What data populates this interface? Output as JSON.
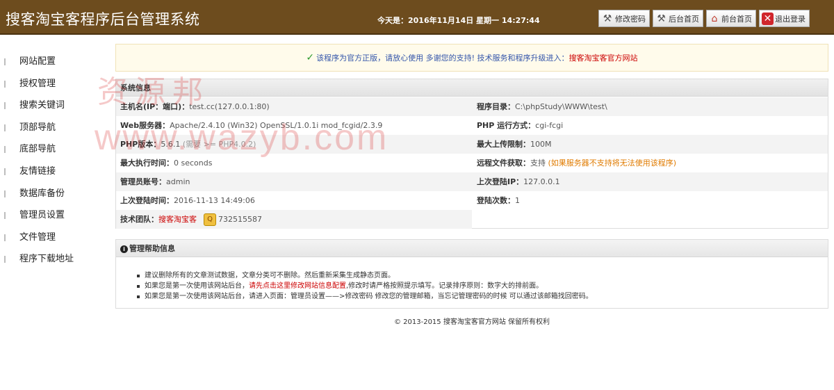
{
  "header": {
    "title": "搜客淘宝客程序后台管理系统",
    "date": "今天是：2016年11月14日 星期一 14:27:44",
    "buttons": [
      {
        "label": "修改密码",
        "icon": "tools-icon"
      },
      {
        "label": "后台首页",
        "icon": "tools-icon"
      },
      {
        "label": "前台首页",
        "icon": "home-icon"
      },
      {
        "label": "退出登录",
        "icon": "close-icon"
      }
    ]
  },
  "sidebar": {
    "items": [
      {
        "label": "网站配置"
      },
      {
        "label": "授权管理"
      },
      {
        "label": "搜索关键词"
      },
      {
        "label": "顶部导航"
      },
      {
        "label": "底部导航"
      },
      {
        "label": "友情链接"
      },
      {
        "label": "数据库备份"
      },
      {
        "label": "管理员设置"
      },
      {
        "label": "文件管理"
      },
      {
        "label": "程序下载地址"
      }
    ]
  },
  "notice": {
    "text": "该程序为官方正版，请放心使用 多谢您的支持! 技术服务和程序升级进入：",
    "link": "搜客淘宝客官方网站"
  },
  "system_info": {
    "title": "系统信息",
    "host_label": "主机名(IP：端口)：",
    "host_value": "test.cc(127.0.0.1:80)",
    "dir_label": "程序目录：",
    "dir_value": "C:\\phpStudy\\WWW\\test\\",
    "web_label": "Web服务器：",
    "web_value": "Apache/2.4.10 (Win32) OpenSSL/1.0.1i mod_fcgid/2.3.9",
    "php_mode_label": "PHP 运行方式：",
    "php_mode_value": "cgi-fcgi",
    "php_ver_label": "PHP版本：",
    "php_ver_value": "5.6.1",
    "php_ver_req": "(需要 >= PHP4.0.2)",
    "upload_label": "最大上传限制：",
    "upload_value": "100M",
    "exec_label": "最大执行时间：",
    "exec_value": "0 seconds",
    "remote_label": "远程文件获取：",
    "remote_value": "支持",
    "remote_note": "(如果服务器不支持将无法使用该程序)",
    "admin_label": "管理员账号：",
    "admin_value": "admin",
    "last_ip_label": "上次登陆IP：",
    "last_ip_value": "127.0.0.1",
    "last_time_label": "上次登陆时间：",
    "last_time_value": "2016-11-13 14:49:06",
    "login_count_label": "登陆次数：",
    "login_count_value": "1",
    "team_label": "技术团队：",
    "team_value": "搜客淘宝客",
    "qq_value": "732515587"
  },
  "help": {
    "title": "管理帮助信息",
    "item1": "建议删除所有的文章测试数据，文章分类可不删除。然后重新采集生成静态页面。",
    "item2_pre": "如果您是第一次使用该网站后台，",
    "item2_link": "请先点击这里修改网站信息配置",
    "item2_post": ",修改时请严格按照提示填写。记录排序原则：数字大的排前面。",
    "item3": "如果您是第一次使用该网站后台，请进入页面：管理员设置——>修改密码 修改您的管理邮箱，当忘记管理密码的时候 可以通过该邮箱找回密码。"
  },
  "footer": {
    "text": "© 2013-2015 搜客淘宝客官方网站 保留所有权利"
  },
  "watermark": {
    "line1": "资源邦",
    "line2": "www.wazyb.com"
  },
  "colors": {
    "header_bg": "#6d4c1e",
    "link_red": "#cc0000",
    "notice_blue": "#3355aa",
    "orange_note": "#e07b00"
  }
}
